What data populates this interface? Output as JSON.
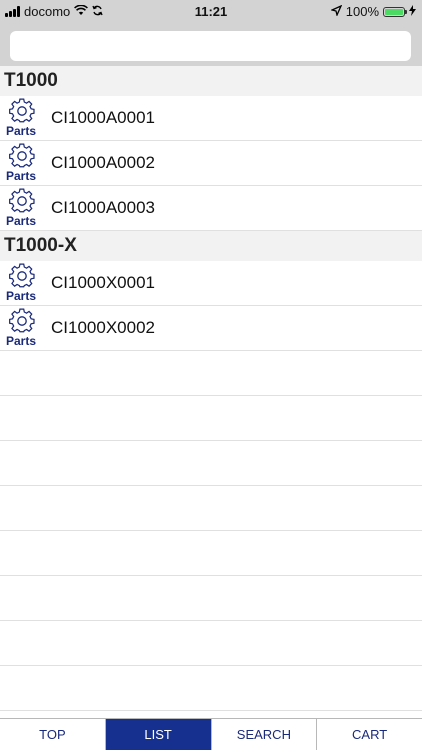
{
  "status_bar": {
    "carrier": "docomo",
    "time": "11:21",
    "battery": "100%",
    "battery_level": 1.0
  },
  "search": {
    "value": "",
    "placeholder": ""
  },
  "sections": [
    {
      "title": "T1000",
      "items": [
        {
          "icon_label": "Parts",
          "label": "CI1000A0001"
        },
        {
          "icon_label": "Parts",
          "label": "CI1000A0002"
        },
        {
          "icon_label": "Parts",
          "label": "CI1000A0003"
        }
      ]
    },
    {
      "title": "T1000-X",
      "items": [
        {
          "icon_label": "Parts",
          "label": "CI1000X0001"
        },
        {
          "icon_label": "Parts",
          "label": "CI1000X0002"
        }
      ]
    }
  ],
  "tabs": [
    {
      "label": "TOP",
      "active": false
    },
    {
      "label": "LIST",
      "active": true
    },
    {
      "label": "SEARCH",
      "active": false
    },
    {
      "label": "CART",
      "active": false
    }
  ],
  "colors": {
    "accent": "#16308f",
    "icon": "#1a2a7a",
    "bar_bg": "#d3d3d3"
  }
}
